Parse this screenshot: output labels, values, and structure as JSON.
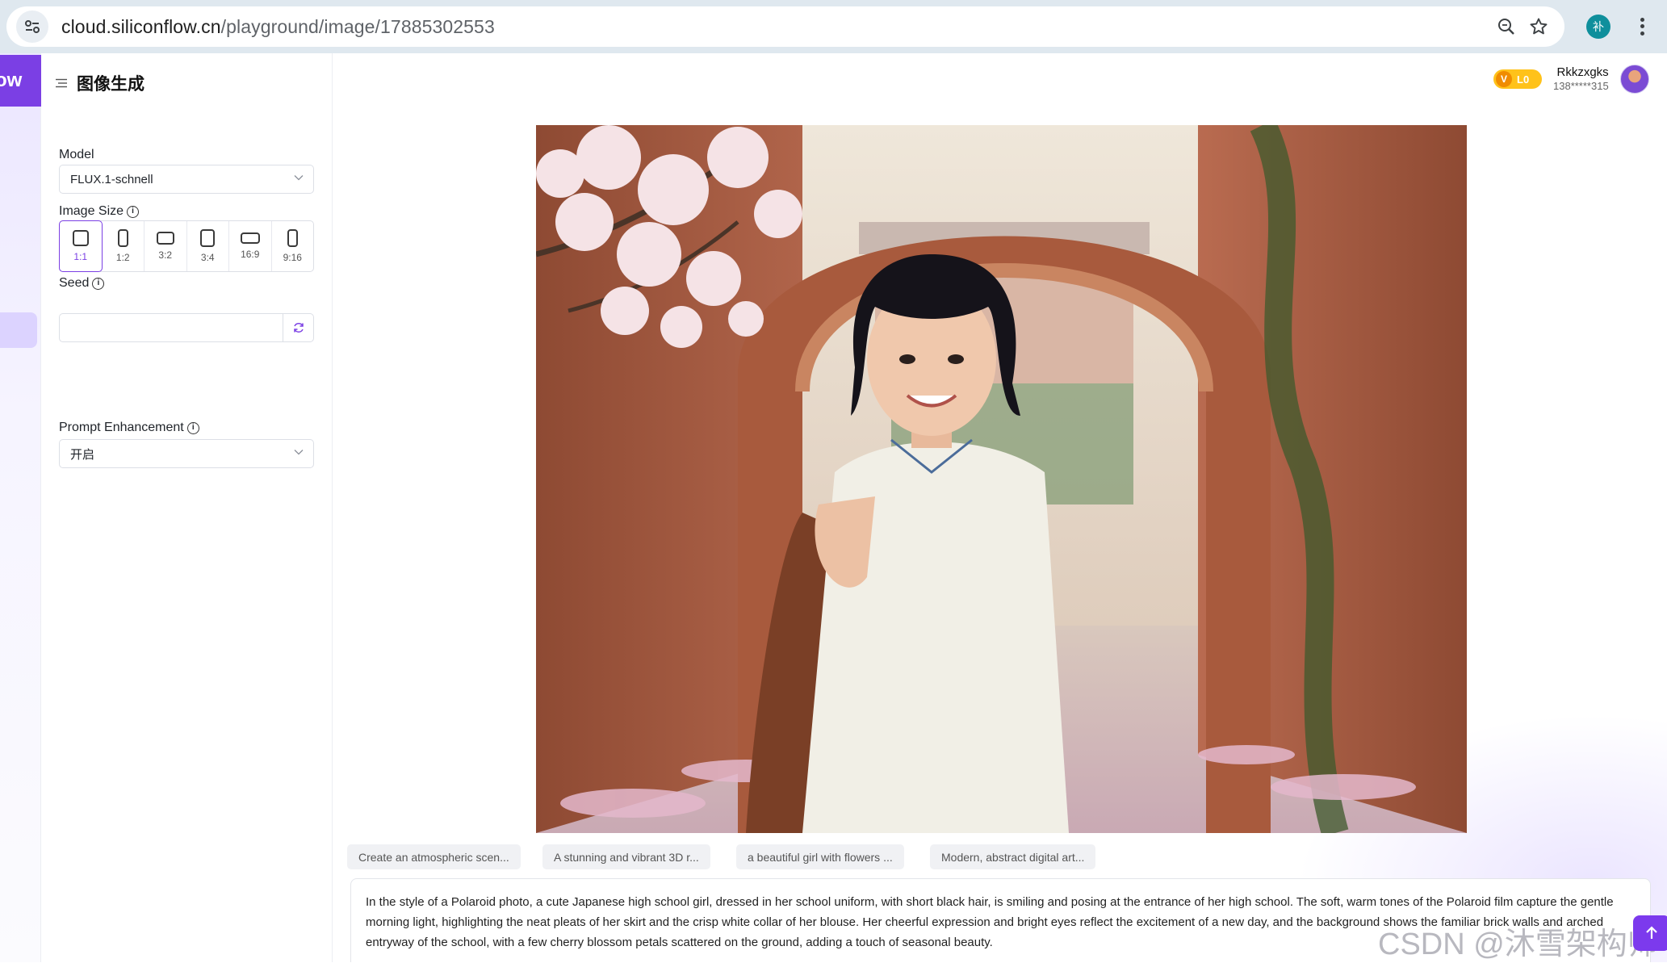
{
  "browser": {
    "url_host": "cloud.siliconflow.cn",
    "url_path": "/playground/image/17885302553",
    "profile_initial": "补"
  },
  "rail": {
    "logo_fragment": "ow"
  },
  "panel": {
    "title": "图像生成",
    "model": {
      "label": "Model",
      "value": "FLUX.1-schnell"
    },
    "image_size": {
      "label": "Image Size",
      "options": [
        "1:1",
        "1:2",
        "3:2",
        "3:4",
        "16:9",
        "9:16"
      ],
      "selected": "1:1"
    },
    "seed": {
      "label": "Seed",
      "value": ""
    },
    "prompt_enhancement": {
      "label": "Prompt Enhancement",
      "value": "开启"
    }
  },
  "account": {
    "vip_badge": "V",
    "level": "L0",
    "username": "Rkkzxgks",
    "phone": "138*****315"
  },
  "prompt_chips": [
    "Create an atmospheric scen...",
    "A stunning and vibrant 3D r...",
    "a beautiful girl with flowers ...",
    "Modern, abstract digital art..."
  ],
  "prompt_text": "In the style of a Polaroid photo, a cute Japanese high school girl, dressed in her school uniform, with short black hair, is smiling and posing at the entrance of her high school. The soft, warm tones of the Polaroid film capture the gentle morning light, highlighting the neat pleats of her skirt and the crisp white collar of her blouse. Her cheerful expression and bright eyes reflect the excitement of a new day, and the background shows the familiar brick walls and arched entryway of the school, with a few cherry blossom petals scattered on the ground, adding a touch of seasonal beauty.",
  "watermark": "CSDN @沐雪架构师",
  "colors": {
    "accent": "#7b3fe4",
    "vip": "#ffc21a",
    "send_button": "#7c3aed"
  }
}
